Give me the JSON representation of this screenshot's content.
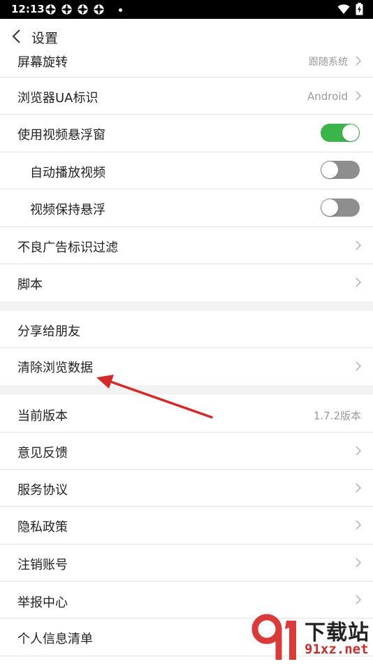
{
  "status_bar": {
    "time": "12:13"
  },
  "header": {
    "title": "设置"
  },
  "rows": {
    "rotate": {
      "label": "屏幕旋转",
      "value": "跟随系统"
    },
    "ua": {
      "label": "浏览器UA标识",
      "value": "Android"
    },
    "float_video": {
      "label": "使用视频悬浮窗",
      "on": true
    },
    "autoplay": {
      "label": "自动播放视频",
      "on": false
    },
    "keep_float": {
      "label": "视频保持悬浮",
      "on": false
    },
    "ad_filter": {
      "label": "不良广告标识过滤"
    },
    "script": {
      "label": "脚本"
    },
    "share": {
      "label": "分享给朋友"
    },
    "clear": {
      "label": "清除浏览数据"
    },
    "version": {
      "label": "当前版本",
      "value": "1.7.2版本"
    },
    "feedback": {
      "label": "意见反馈"
    },
    "service": {
      "label": "服务协议"
    },
    "privacy": {
      "label": "隐私政策"
    },
    "cancel": {
      "label": "注销账号"
    },
    "report": {
      "label": "举报中心"
    },
    "info": {
      "label": "个人信息清单"
    }
  },
  "watermark": {
    "title": "下载站",
    "site": "91xz.net"
  },
  "colors": {
    "toggle_on": "#3bb54a",
    "toggle_off": "#8e8e8e",
    "arrow": "#d42a2a"
  }
}
